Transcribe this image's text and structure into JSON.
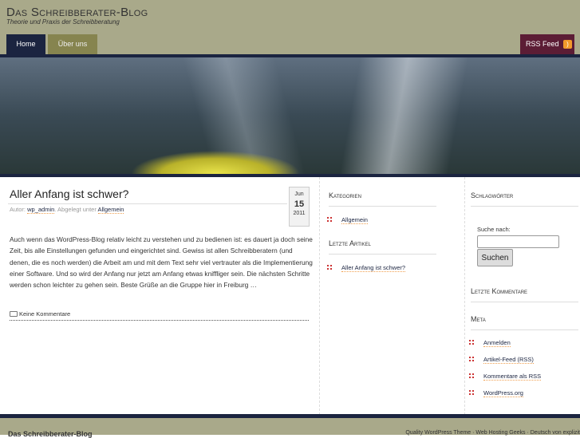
{
  "header": {
    "title": "Das Schreibberater-Blog",
    "tagline": "Theorie und Praxis der Schreibberatung"
  },
  "nav": {
    "tabs": [
      {
        "label": "Home"
      },
      {
        "label": "Über uns"
      }
    ],
    "rss_label": "RSS Feed"
  },
  "post": {
    "title": "Aller Anfang ist schwer?",
    "author_prefix": "Autor:",
    "author": "wp_admin",
    "filed_prefix": ". Abgelegt unter",
    "category": "Allgemein",
    "date": {
      "month": "Jun",
      "day": "15",
      "year": "2011"
    },
    "body": "Auch wenn das WordPress-Blog relativ leicht zu verstehen und zu bedienen ist: es dauert ja doch seine Zeit, bis alle Einstellungen gefunden und eingerichtet sind. Gewiss ist allen Schreibberatern (und denen, die es noch werden) die Arbeit am und mit dem Text sehr viel vertrauter als die Implementierung einer Software. Und so wird der Anfang nur jetzt am Anfang etwas kniffliger sein. Die nächsten Schritte werden schon leichter zu gehen sein. Beste Grüße an die Gruppe hier in Freiburg …",
    "comments": "Keine Kommentare"
  },
  "sidebar1": {
    "categories_title": "Kategorien",
    "categories": [
      "Allgemein"
    ],
    "recent_title": "Letzte Artikel",
    "recent": [
      "Aller Anfang ist schwer?"
    ]
  },
  "sidebar2": {
    "tags_title": "Schlagwörter",
    "search_label": "Suche nach:",
    "search_value": "",
    "search_button": "Suchen",
    "comments_title": "Letzte Kommentare",
    "meta_title": "Meta",
    "meta": [
      "Anmelden",
      "Artikel-Feed (RSS)",
      "Kommentare als RSS",
      "WordPress.org"
    ]
  },
  "footer": {
    "title": "Das Schreibberater-Blog",
    "credits": "Quality WordPress Theme · Web Hosting Geeks · Deutsch von explizit"
  }
}
